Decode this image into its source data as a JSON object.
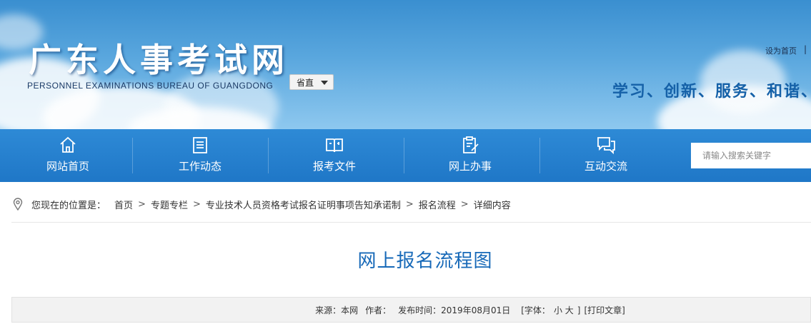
{
  "header": {
    "site_title": "广东人事考试网",
    "site_subtitle": "PERSONNEL EXAMINATIONS BUREAU OF GUANGDONG",
    "region_selected": "省直",
    "top_link": "设为首页",
    "top_separator": "|",
    "slogan": "学习、创新、服务、和谐、"
  },
  "nav": {
    "items": [
      {
        "label": "网站首页",
        "icon": "home-icon"
      },
      {
        "label": "工作动态",
        "icon": "document-list-icon"
      },
      {
        "label": "报考文件",
        "icon": "book-icon"
      },
      {
        "label": "网上办事",
        "icon": "edit-clipboard-icon"
      },
      {
        "label": "互动交流",
        "icon": "chat-bubbles-icon"
      }
    ],
    "search_placeholder": "请输入搜索关键字"
  },
  "breadcrumb": {
    "prefix": "您现在的位置是：",
    "items": [
      "首页",
      "专题专栏",
      "专业技术人员资格考试报名证明事项告知承诺制",
      "报名流程",
      "详细内容"
    ],
    "separator": ">"
  },
  "article": {
    "title": "网上报名流程图",
    "source": "来源：本网",
    "author": "作者：",
    "publish_time": "发布时间：2019年08月01日",
    "font_size_label": "[字体：",
    "font_small": "小",
    "font_large": "大",
    "font_size_close": "]",
    "print": "[打印文章]"
  },
  "colors": {
    "nav_bg": "#1f77c7",
    "title_blue": "#1769b8",
    "slogan_blue": "#1561a8"
  }
}
